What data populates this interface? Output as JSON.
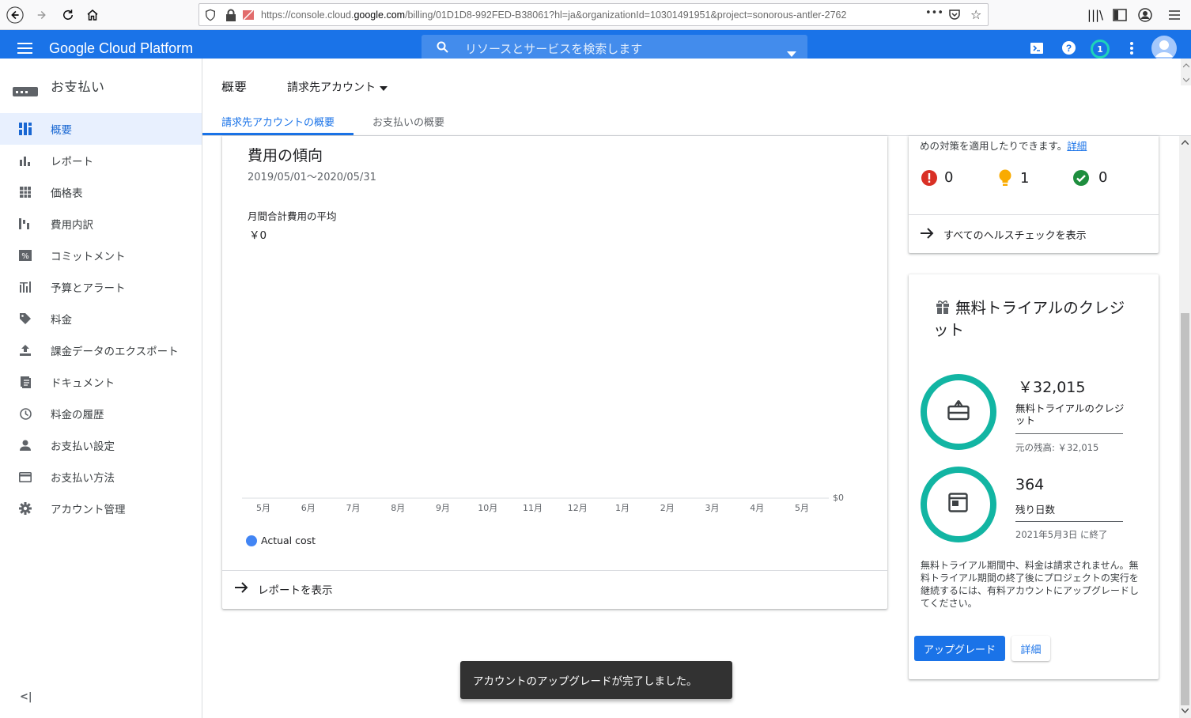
{
  "browser": {
    "url_prefix": "https://console.cloud.",
    "url_domain": "google.com",
    "url_suffix": "/billing/01D1D8-992FED-B38061?hl=ja&organizationId=10301491951&project=sonorous-antler-2762",
    "more": "•••"
  },
  "header": {
    "app_title": "Google Cloud Platform",
    "search_placeholder": "リソースとサービスを検索します",
    "notification_count": "1"
  },
  "sidebar": {
    "section_title": "お支払い",
    "items": [
      {
        "label": "概要",
        "icon": "dashboard-icon"
      },
      {
        "label": "レポート",
        "icon": "bar-chart-icon"
      },
      {
        "label": "価格表",
        "icon": "table-icon"
      },
      {
        "label": "費用内訳",
        "icon": "waterfall-icon"
      },
      {
        "label": "コミットメント",
        "icon": "percent-icon"
      },
      {
        "label": "予算とアラート",
        "icon": "budget-icon"
      },
      {
        "label": "料金",
        "icon": "tag-icon"
      },
      {
        "label": "課金データのエクスポート",
        "icon": "export-icon"
      },
      {
        "label": "ドキュメント",
        "icon": "document-icon"
      },
      {
        "label": "料金の履歴",
        "icon": "history-icon"
      },
      {
        "label": "お支払い設定",
        "icon": "person-icon"
      },
      {
        "label": "お支払い方法",
        "icon": "credit-card-icon"
      },
      {
        "label": "アカウント管理",
        "icon": "gear-icon"
      }
    ],
    "collapse": "<|"
  },
  "subheader": {
    "page_title": "概要",
    "account_selector": "請求先アカウント",
    "tabs": [
      "請求先アカウントの概要",
      "お支払いの概要"
    ]
  },
  "cost_card": {
    "title": "費用の傾向",
    "date_range": "2019/05/01〜2020/05/31",
    "avg_label": "月間合計費用の平均",
    "avg_value": "￥0",
    "view_report": "レポートを表示"
  },
  "chart_data": {
    "type": "line",
    "categories": [
      "5月",
      "6月",
      "7月",
      "8月",
      "9月",
      "10月",
      "11月",
      "12月",
      "1月",
      "2月",
      "3月",
      "4月",
      "5月"
    ],
    "series": [
      {
        "name": "Actual cost",
        "values": [
          0,
          0,
          0,
          0,
          0,
          0,
          0,
          0,
          0,
          0,
          0,
          0,
          0
        ],
        "color": "#4285f4"
      }
    ],
    "ytick": "$0",
    "legend_position": "bottom-left",
    "grid": false
  },
  "health_card": {
    "desc_tail": "めの対策を適用したりできます。",
    "detail_link": "詳細",
    "counts": [
      {
        "icon": "error-icon",
        "value": "0",
        "color": "#d93025"
      },
      {
        "icon": "lightbulb-icon",
        "value": "1",
        "color": "#f9ab00"
      },
      {
        "icon": "check-circle-icon",
        "value": "0",
        "color": "#1e8e3e"
      }
    ],
    "view_all": "すべてのヘルスチェックを表示"
  },
  "trial_card": {
    "title": "無料トライアルのクレジット",
    "credit_value": "￥32,015",
    "credit_label": "無料トライアルのクレジット",
    "original_balance": "元の残高: ￥32,015",
    "days_value": "364",
    "days_label": "残り日数",
    "end_date": "2021年5月3日 に終了",
    "note": "無料トライアル期間中、料金は請求されません。無料トライアル期間の終了後にプロジェクトの実行を継続するには、有料アカウントにアップグレードしてください。",
    "upgrade_button": "アップグレード",
    "detail_button": "詳細"
  },
  "toast": {
    "message": "アカウントのアップグレードが完了しました。"
  }
}
